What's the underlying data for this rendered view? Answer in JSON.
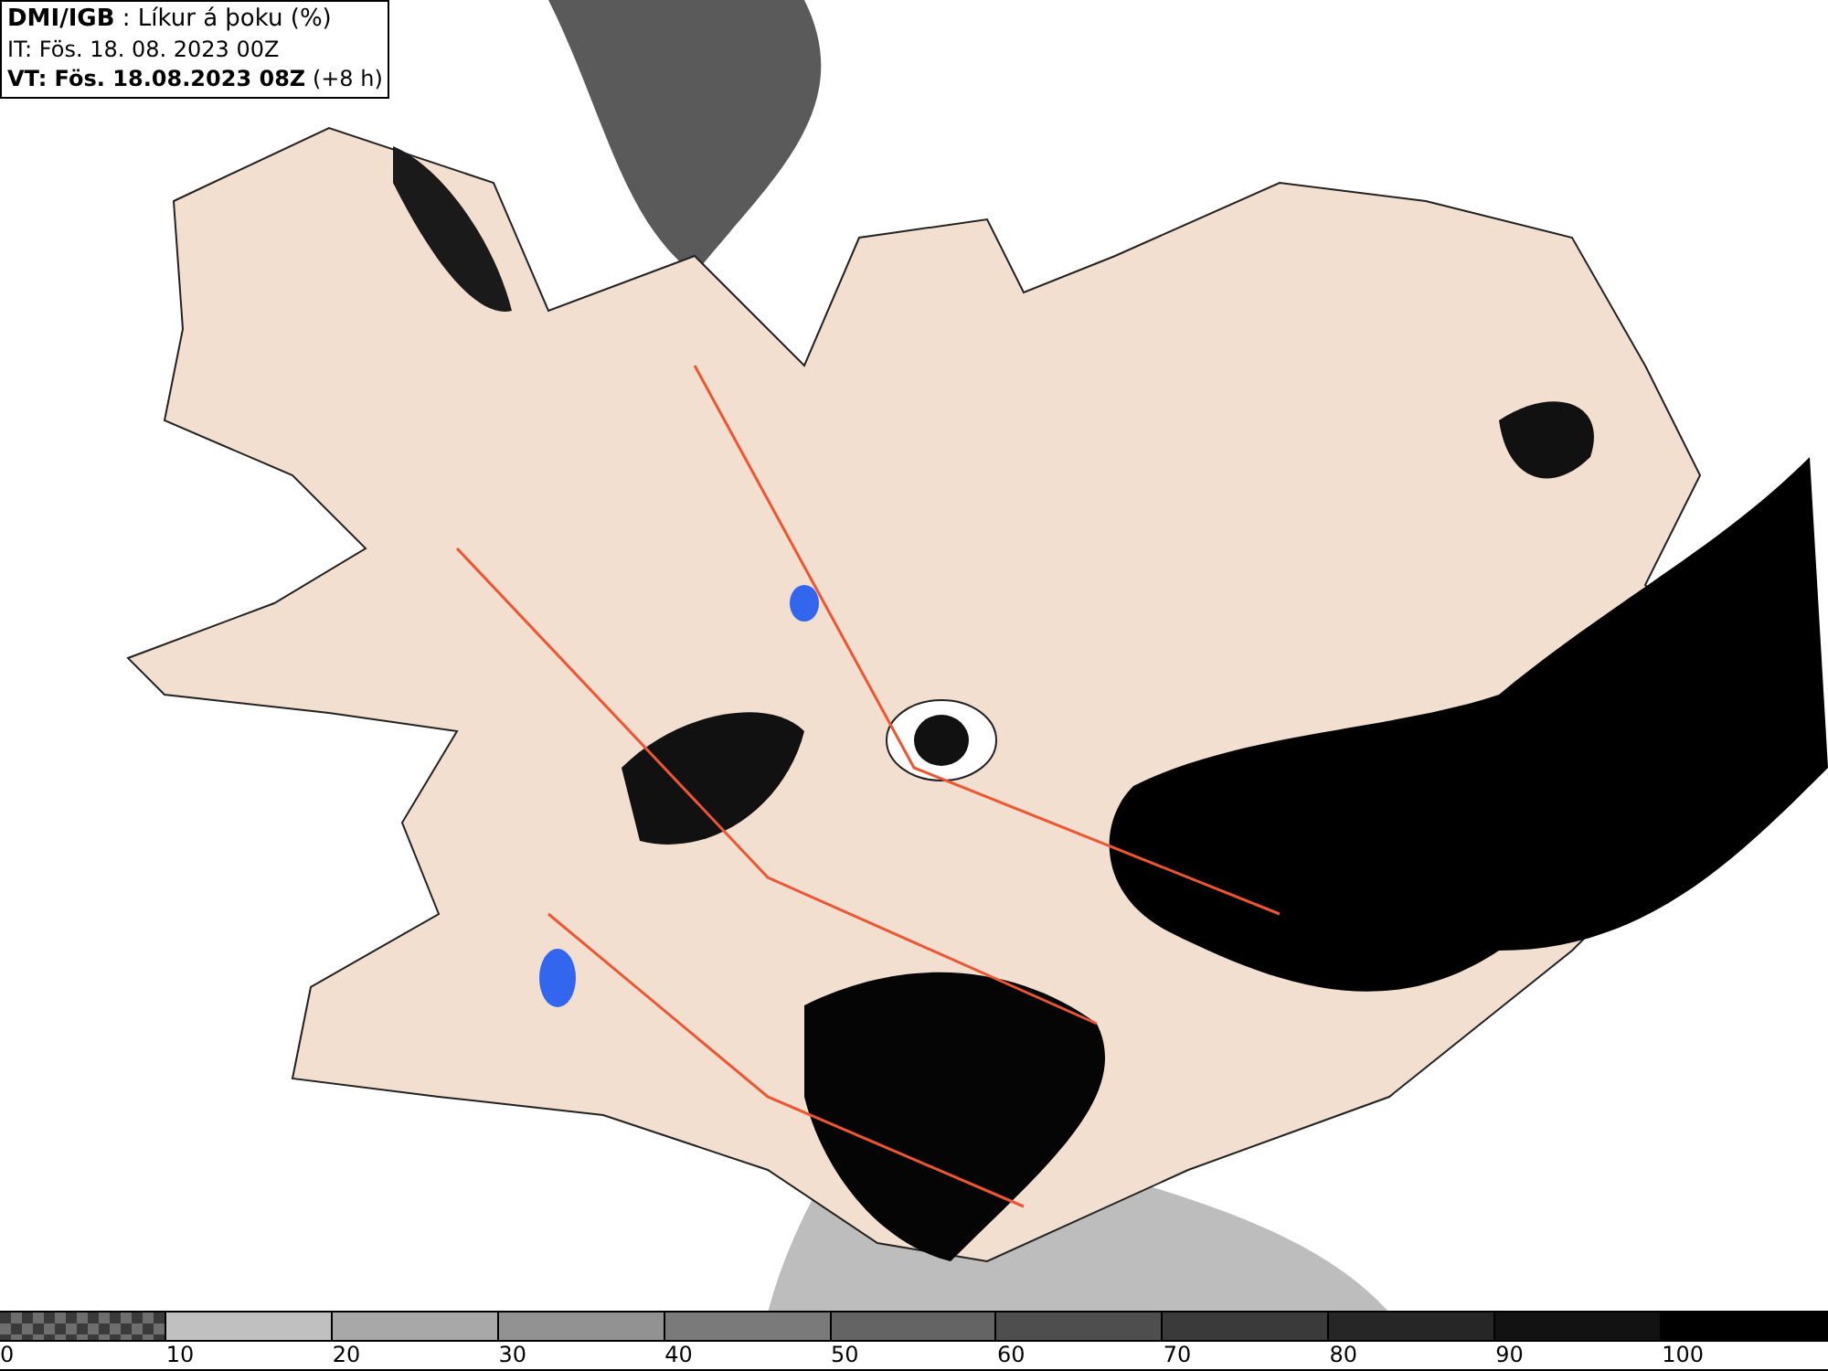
{
  "header": {
    "lines": [
      "**DMI/IGB** : Líkur á þoku (%)",
      "IT: Fös. 18. 08. 2023 00Z",
      "**VT: Fös. 18.08.2023 08Z** (+8 h)"
    ]
  },
  "legend": [
    {
      "label": "0",
      "color": "#6e6e6e",
      "kind": "checker"
    },
    {
      "label": "10",
      "color": "#c0c0c0",
      "kind": "solid"
    },
    {
      "label": "20",
      "color": "#a8a8a8",
      "kind": "solid"
    },
    {
      "label": "30",
      "color": "#929292",
      "kind": "solid"
    },
    {
      "label": "40",
      "color": "#7a7a7a",
      "kind": "solid"
    },
    {
      "label": "50",
      "color": "#646464",
      "kind": "solid"
    },
    {
      "label": "60",
      "color": "#4e4e4e",
      "kind": "solid"
    },
    {
      "label": "70",
      "color": "#3a3a3a",
      "kind": "solid"
    },
    {
      "label": "80",
      "color": "#262626",
      "kind": "solid"
    },
    {
      "label": "90",
      "color": "#121212",
      "kind": "solid"
    },
    {
      "label": "100",
      "color": "#000000",
      "kind": "solid"
    }
  ]
}
